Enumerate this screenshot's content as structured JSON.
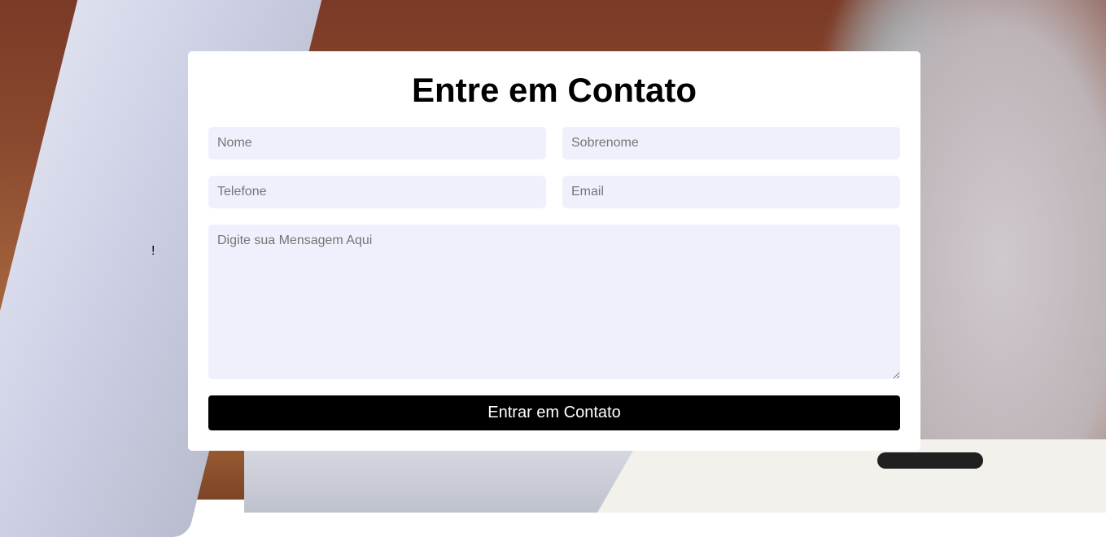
{
  "page": {
    "marker_glyph": "!"
  },
  "form": {
    "title": "Entre em Contato",
    "first_name_placeholder": "Nome",
    "last_name_placeholder": "Sobrenome",
    "phone_placeholder": "Telefone",
    "email_placeholder": "Email",
    "message_placeholder": "Digite sua Mensagem Aqui",
    "submit_label": "Entrar em Contato"
  },
  "colors": {
    "card_background": "#ffffff",
    "input_background": "#f0f0fd",
    "button_background": "#000000",
    "button_text": "#ffffff"
  }
}
